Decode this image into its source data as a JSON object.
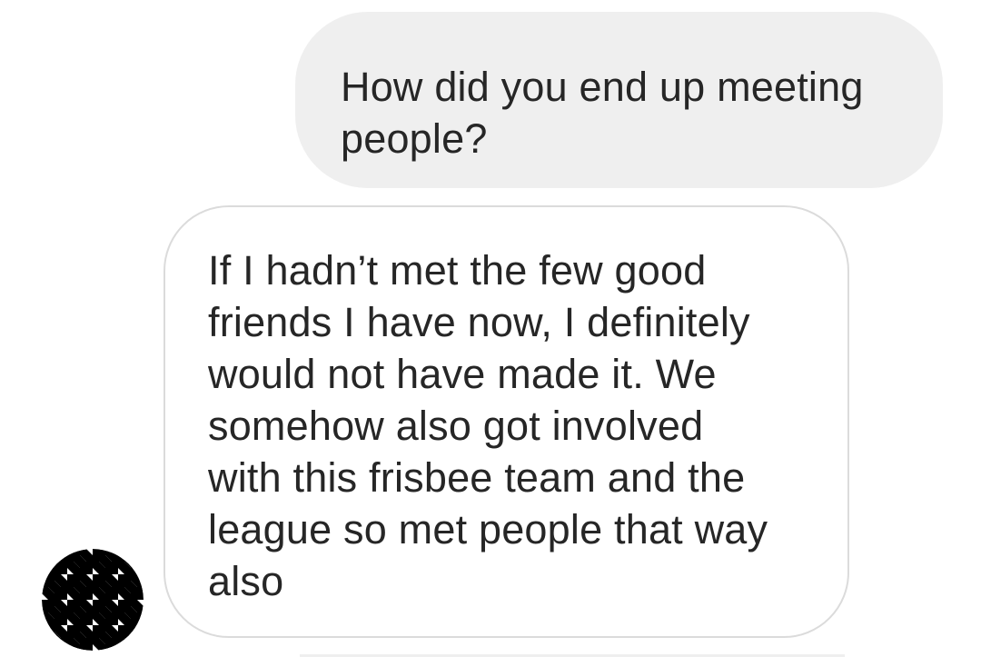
{
  "conversation": {
    "sent_message": {
      "lines": [
        "How did you end up meeting",
        "people?"
      ]
    },
    "received_message": {
      "lines": [
        "If I hadn’t met the few good",
        "friends I have now, I definitely",
        "would not have made it. We",
        "somehow also got involved",
        "with this frisbee team and the",
        "league so met people that way",
        "also"
      ]
    },
    "contact_avatar": {
      "icon": "houndstooth-pattern-avatar",
      "colors": [
        "#000000",
        "#ffffff"
      ]
    }
  },
  "colors": {
    "sent_bubble_bg": "#efefef",
    "received_bubble_border": "#dbdbdb",
    "text": "#262626"
  }
}
